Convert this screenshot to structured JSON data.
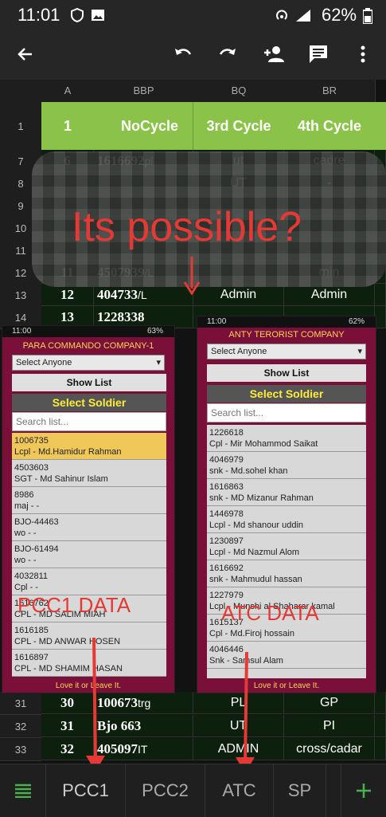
{
  "status": {
    "time": "11:01",
    "battery": "62%"
  },
  "toolbar": {
    "back": "back",
    "undo": "undo",
    "redo": "redo",
    "share": "add-person",
    "comment": "comment",
    "more": "more"
  },
  "columns": [
    "A",
    "B",
    "BP",
    "BQ",
    "BR"
  ],
  "header_row": {
    "row": "1",
    "a": "1",
    "b": "NoCycle",
    "bq": "3rd Cycle",
    "br": "4th Cycle"
  },
  "rows": [
    {
      "num": "7",
      "a": "6",
      "b": "1616692",
      "c": "pl",
      "bq": "ut",
      "br": "cadre"
    },
    {
      "num": "8",
      "a": "",
      "b": "",
      "c": "",
      "bq": "UT",
      "br": "-"
    },
    {
      "num": "9",
      "a": "",
      "b": "",
      "c": "",
      "bq": "",
      "br": ""
    },
    {
      "num": "10",
      "a": "",
      "b": "",
      "c": "",
      "bq": "",
      "br": ""
    },
    {
      "num": "11",
      "a": "",
      "b": "",
      "c": "",
      "bq": "",
      "br": ""
    },
    {
      "num": "12",
      "a": "11",
      "b": "4507939",
      "c": "/L",
      "bq": "",
      "br": "min"
    },
    {
      "num": "13",
      "a": "12",
      "b": "404733",
      "c": "/L",
      "bq": "Admin",
      "br": "Admin"
    },
    {
      "num": "14",
      "a": "13",
      "b": "1228338",
      "c": "",
      "bq": "",
      "br": ""
    }
  ],
  "bottom_rows": [
    {
      "num": "31",
      "a": "30",
      "b": "100673",
      "c": "trg",
      "bq": "PL",
      "br": "GP"
    },
    {
      "num": "32",
      "a": "31",
      "b": "Bjo 663",
      "c": "",
      "bq": "UT",
      "br": "PI"
    },
    {
      "num": "33",
      "a": "32",
      "b": "405097",
      "c": "IT",
      "bq": "ADMIN",
      "br": "cross/cadar"
    }
  ],
  "overlay": {
    "question": "Its possible?"
  },
  "phone_left": {
    "status_time": "11:00",
    "status_batt": "63%",
    "title": "PARA COMMANDO COMPANY-1",
    "select": "Select Anyone",
    "show_list": "Show List",
    "select_soldier": "Select Soldier",
    "search_placeholder": "Search list...",
    "items": [
      {
        "line1": "1006735",
        "line2": "Lcpl  -  Md.Hamidur Rahman"
      },
      {
        "line1": "4503603",
        "line2": "SGT  -  Md Sahinur Islam"
      },
      {
        "line1": "8986",
        "line2": "maj  -  -"
      },
      {
        "line1": "BJO-44463",
        "line2": "wo  -  -"
      },
      {
        "line1": "BJO-61494",
        "line2": "wo  -  -"
      },
      {
        "line1": "4032811",
        "line2": "Cpl  -  -"
      },
      {
        "line1": "1616762",
        "line2": "CPL  -  MD SALIM MIAH"
      },
      {
        "line1": "1616185",
        "line2": "CPL  -  MD ANWAR HOSEN"
      },
      {
        "line1": "1616897",
        "line2": "CPL  -  MD SHAMIM HASAN"
      }
    ],
    "footer": "Love it or Leave It.",
    "label": "PCC1 DATA"
  },
  "phone_right": {
    "status_time": "11:00",
    "status_batt": "62%",
    "title": "ANTY TERORIST COMPANY",
    "select": "Select Anyone",
    "show_list": "Show List",
    "select_soldier": "Select Soldier",
    "search_placeholder": "Search list...",
    "items": [
      {
        "line1": "1226618",
        "line2": "Cpl  -  Mir Mohammod Saikat"
      },
      {
        "line1": "4046979",
        "line2": "snk  -  Md.sohel khan"
      },
      {
        "line1": "1616863",
        "line2": "snk  -  MD Mizanur Rahman"
      },
      {
        "line1": "1446978",
        "line2": "Lcpl  -  Md shanour uddin"
      },
      {
        "line1": "1230897",
        "line2": "Lcpl  -  Md Nazmul Alom"
      },
      {
        "line1": "1616692",
        "line2": "snk  -  Mahmudul hassan"
      },
      {
        "line1": "1227979",
        "line2": "Lcpl  -  Munshi al Shaharar kamal"
      },
      {
        "line1": "1615137",
        "line2": "Cpl  -  Md.Firoj hossain"
      },
      {
        "line1": "4046446",
        "line2": "Snk  -  Samsul Alam"
      }
    ],
    "footer": "Love it or Leave It.",
    "label": "ATC DATA"
  },
  "tabs": [
    "PCC1",
    "PCC2",
    "ATC",
    "SP"
  ],
  "colors": {
    "header_green": "#8bc34a",
    "arrow_red": "#e53935",
    "app_maroon": "#7a0f3a",
    "add_green": "#4caf50"
  }
}
